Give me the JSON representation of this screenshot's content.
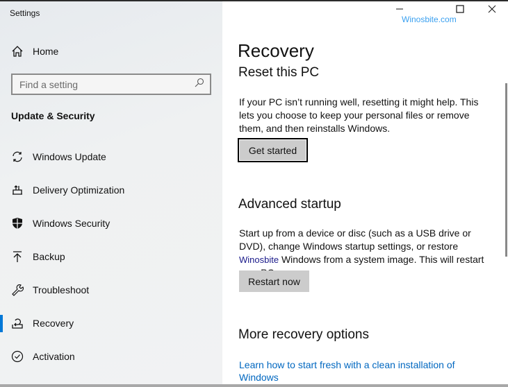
{
  "window": {
    "title": "Settings",
    "watermark": "Winosbite.com"
  },
  "sidebar": {
    "home": "Home",
    "search_placeholder": "Find a setting",
    "section": "Update & Security",
    "items": [
      {
        "label": "Windows Update",
        "icon": "sync-icon"
      },
      {
        "label": "Delivery Optimization",
        "icon": "delivery-optimization-icon"
      },
      {
        "label": "Windows Security",
        "icon": "shield-icon"
      },
      {
        "label": "Backup",
        "icon": "backup-arrow-icon"
      },
      {
        "label": "Troubleshoot",
        "icon": "wrench-icon"
      },
      {
        "label": "Recovery",
        "icon": "recovery-icon",
        "selected": true
      },
      {
        "label": "Activation",
        "icon": "check-circle-icon"
      }
    ],
    "accent": "#0078d7"
  },
  "main": {
    "title": "Recovery",
    "reset": {
      "heading": "Reset this PC",
      "text": "If your PC isn’t running well, resetting it might help. This lets you choose to keep your personal files or remove them, and then reinstalls Windows.",
      "button": "Get started"
    },
    "advanced": {
      "heading": "Advanced startup",
      "text_before": "Start up from a device or disc (such as a USB drive or DVD), change Windows startup settings, or restore",
      "inline_watermark": "Winosbite",
      "text_after": "Windows from a system image. This will restart your PC.",
      "button": "Restart now"
    },
    "more": {
      "heading": "More recovery options",
      "link": "Learn how to start fresh with a clean installation of Windows"
    },
    "link_color": "#0067c0"
  }
}
